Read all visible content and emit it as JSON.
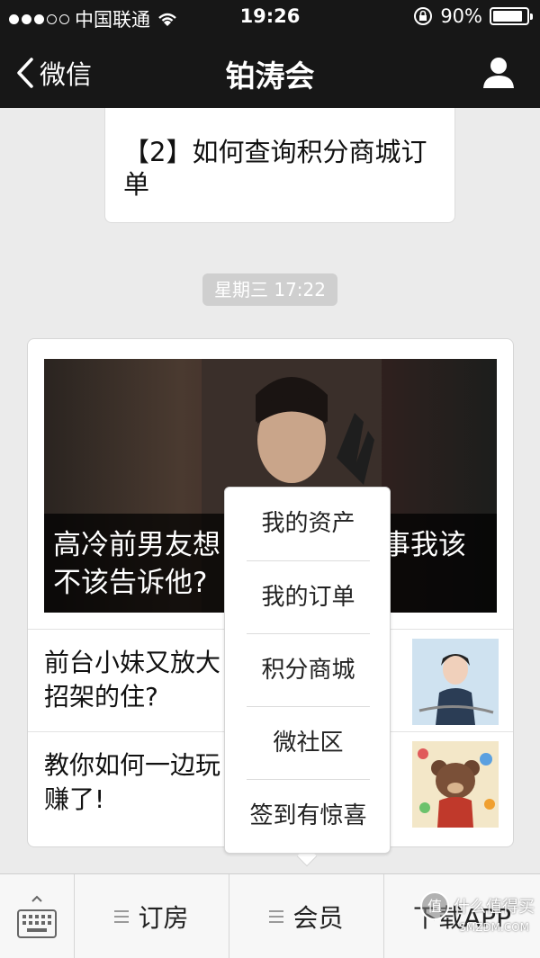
{
  "status_bar": {
    "carrier": "中国联通",
    "time": "19:26",
    "battery": "90%",
    "battery_level": 0.9
  },
  "nav": {
    "back_label": "微信",
    "title": "铂涛会"
  },
  "messages": {
    "card_text": "【2】如何查询积分商城订单",
    "timestamp": "星期三 17:22"
  },
  "news": {
    "hero_caption": "高冷前男友想… 事我该不该告诉他?",
    "hero_caption_line1": "高冷前男友想",
    "hero_caption_line1_tail": "事我该",
    "hero_caption_line2": "不该告诉他?",
    "items": [
      {
        "title_line1": "前台小妹又放大",
        "title_line2": "招架的住?"
      },
      {
        "title_line1": "教你如何一边玩",
        "title_line2": "赚了!"
      }
    ]
  },
  "popup_menu": {
    "items": [
      "我的资产",
      "我的订单",
      "积分商城",
      "微社区",
      "签到有惊喜"
    ]
  },
  "bottom_menu": {
    "items": [
      "订房",
      "会员",
      "下载APP"
    ]
  },
  "watermark": {
    "line1": "什么值得买",
    "line2": "SMZDM.COM"
  },
  "colors": {
    "nav_bg": "#171717",
    "page_bg": "#ebebeb",
    "timestamp_bg": "#cfcfcf"
  }
}
